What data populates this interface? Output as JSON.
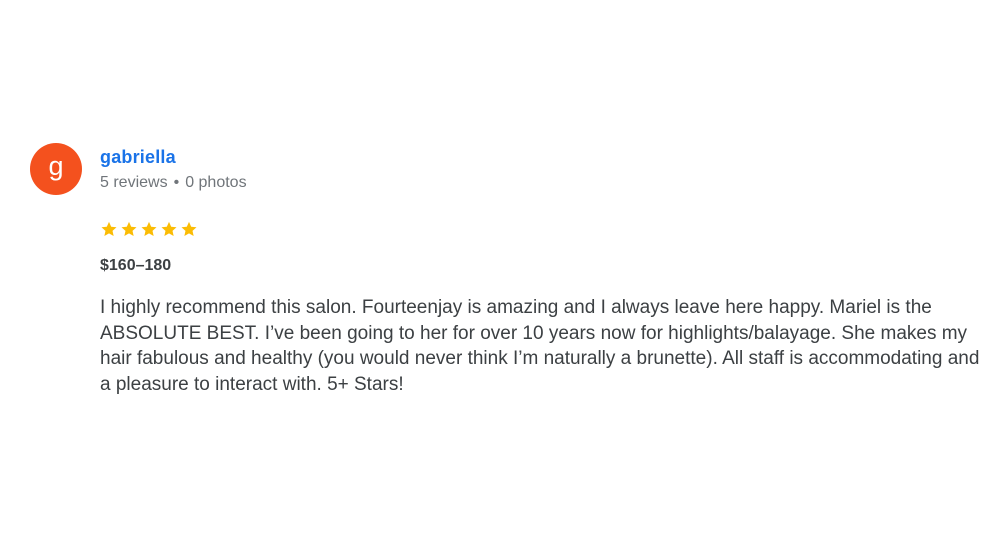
{
  "reviewer": {
    "avatar_letter": "g",
    "avatar_color": "#f4511e",
    "name": "gabriella",
    "reviews_count": "5 reviews",
    "separator": "•",
    "photos_count": "0 photos"
  },
  "rating": {
    "stars": 5,
    "max": 5,
    "star_color": "#fbbc04",
    "icon": "star-icon"
  },
  "price": "$160–180",
  "review_text": "I highly recommend this salon. Fourteenjay is amazing and I always leave here happy. Mariel is the ABSOLUTE BEST. I’ve been going to her for over 10 years now for highlights/balayage. She makes my hair fabulous and healthy (you would never think I’m naturally a brunette). All staff is accommodating and a pleasure to interact with. 5+ Stars!"
}
